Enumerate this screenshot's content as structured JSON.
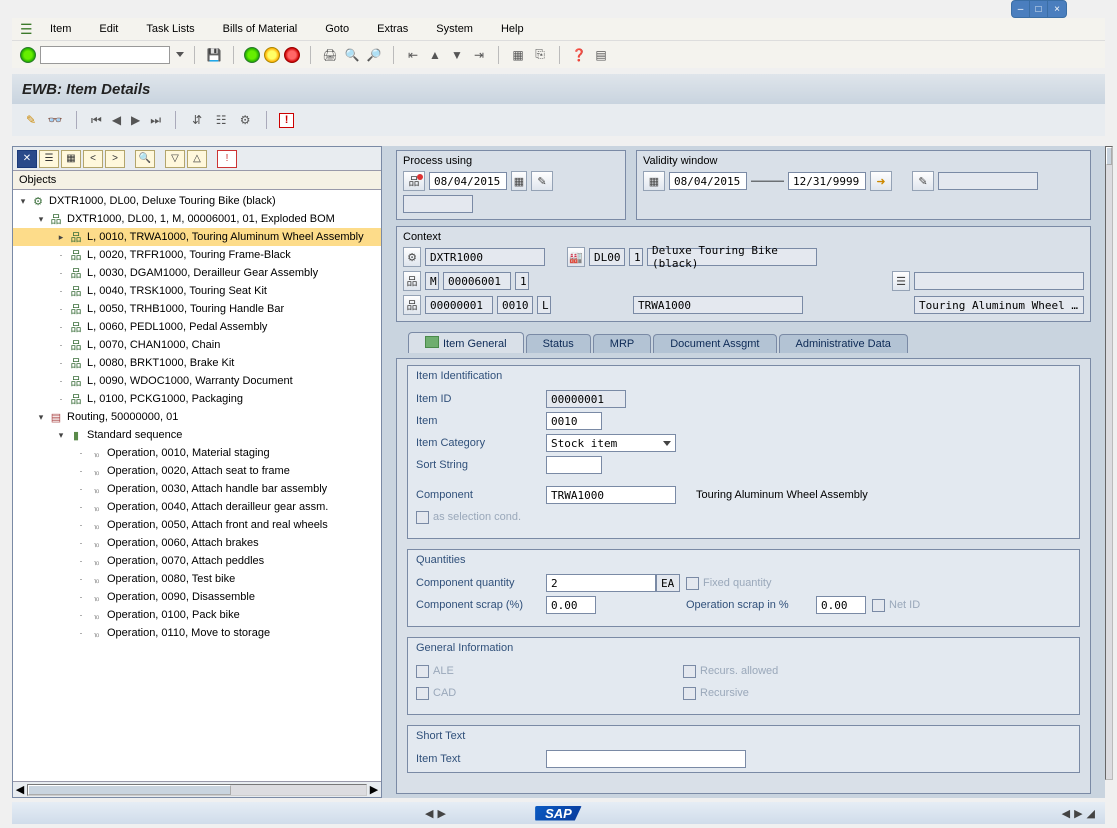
{
  "menu": {
    "items": [
      "Item",
      "Edit",
      "Task Lists",
      "Bills of Material",
      "Goto",
      "Extras",
      "System",
      "Help"
    ]
  },
  "page_title": "EWB: Item Details",
  "tree": {
    "header": "Objects",
    "root": "DXTR1000, DL00, Deluxe Touring Bike (black)",
    "bom": "DXTR1000, DL00, 1, M, 00006001, 01, Exploded BOM",
    "items": [
      "L, 0010, TRWA1000, Touring Aluminum Wheel Assembly",
      "L, 0020, TRFR1000, Touring Frame-Black",
      "L, 0030, DGAM1000, Derailleur Gear Assembly",
      "L, 0040, TRSK1000, Touring Seat Kit",
      "L, 0050, TRHB1000, Touring Handle Bar",
      "L, 0060, PEDL1000, Pedal Assembly",
      "L, 0070, CHAN1000, Chain",
      "L, 0080, BRKT1000, Brake Kit",
      "L, 0090, WDOC1000, Warranty Document",
      "L, 0100, PCKG1000, Packaging"
    ],
    "routing": "Routing, 50000000, 01",
    "std_seq": "Standard sequence",
    "ops": [
      "Operation, 0010, Material staging",
      "Operation, 0020, Attach seat to frame",
      "Operation, 0030, Attach handle bar assembly",
      "Operation, 0040, Attach derailleur gear assm.",
      "Operation, 0050, Attach front and real wheels",
      "Operation, 0060, Attach brakes",
      "Operation, 0070, Attach peddles",
      "Operation, 0080, Test bike",
      "Operation, 0090, Disassemble",
      "Operation, 0100, Pack bike",
      "Operation, 0110, Move to storage"
    ]
  },
  "process_using": {
    "title": "Process using",
    "date": "08/04/2015"
  },
  "validity": {
    "title": "Validity window",
    "from": "08/04/2015",
    "to": "12/31/9999",
    "dash": "———"
  },
  "context": {
    "title": "Context",
    "material": "DXTR1000",
    "plant": "DL00",
    "one": "1",
    "desc": "Deluxe Touring Bike (black)",
    "m": "M",
    "code1": "00006001",
    "code1s": "1",
    "code2a": "00000001",
    "code2b": "0010",
    "code2c": "L",
    "component": "TRWA1000",
    "component_desc": "Touring Aluminum Wheel …"
  },
  "tabs": [
    "Item General",
    "Status",
    "MRP",
    "Document Assgmt",
    "Administrative Data"
  ],
  "item_id_section": {
    "title": "Item Identification",
    "lbl_item_id": "Item ID",
    "item_id": "00000001",
    "lbl_item": "Item",
    "item": "0010",
    "lbl_cat": "Item Category",
    "cat": "Stock item",
    "lbl_sort": "Sort String",
    "lbl_component": "Component",
    "component": "TRWA1000",
    "component_desc_long": "Touring Aluminum Wheel Assembly",
    "as_selection": "as selection cond."
  },
  "qty_section": {
    "title": "Quantities",
    "lbl_qty": "Component quantity",
    "qty": "2",
    "uom": "EA",
    "fixed": "Fixed quantity",
    "lbl_scrap": "Component scrap (%)",
    "scrap": "0.00",
    "lbl_op_scrap": "Operation scrap in %",
    "op_scrap": "0.00",
    "net": "Net ID"
  },
  "gen_section": {
    "title": "General Information",
    "ale": "ALE",
    "recurs_allowed": "Recurs. allowed",
    "cad": "CAD",
    "recursive": "Recursive"
  },
  "short_text": {
    "title": "Short Text",
    "lbl": "Item Text"
  },
  "sap": "SAP"
}
